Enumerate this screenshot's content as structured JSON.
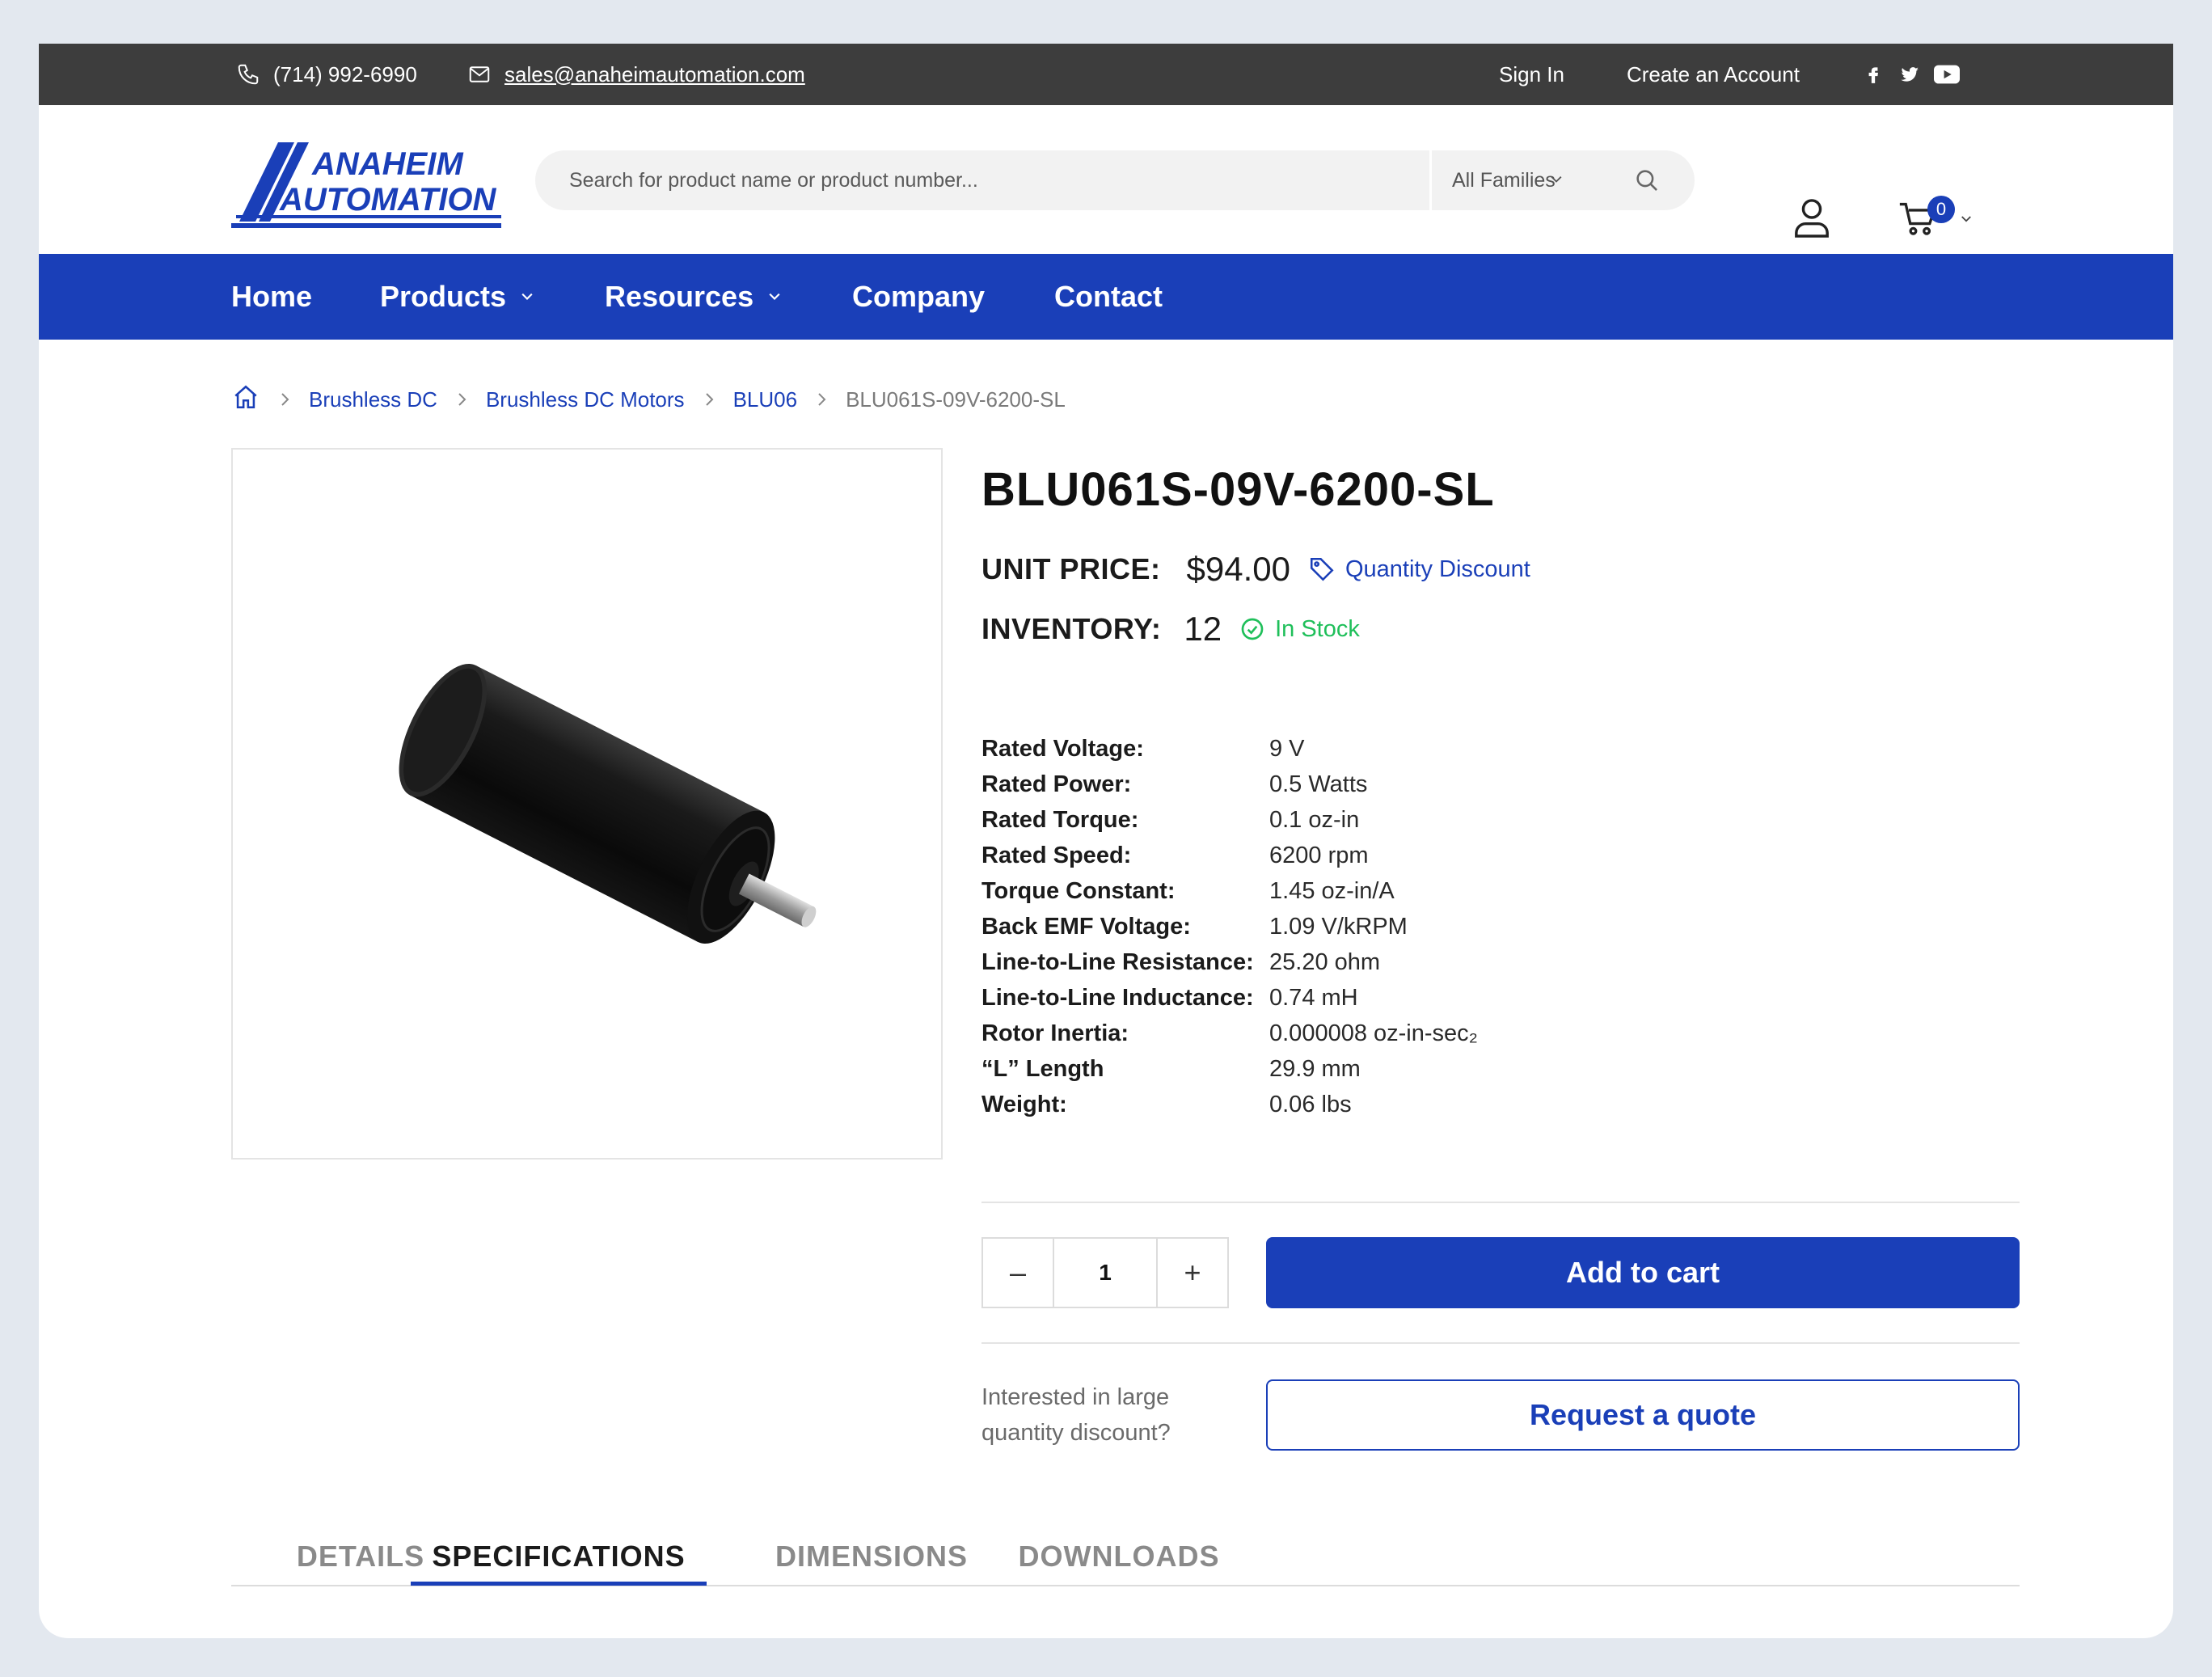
{
  "topbar": {
    "phone": "(714) 992-6990",
    "email": "sales@anaheimautomation.com",
    "sign_in": "Sign In",
    "create_account": "Create an Account",
    "social_icons": [
      "facebook-icon",
      "twitter-icon",
      "youtube-icon"
    ]
  },
  "header": {
    "logo_text": [
      "ANAHEIM",
      "AUTOMATION"
    ],
    "search_placeholder": "Search for product name or product number...",
    "family_select": "All Families",
    "cart_count": "0"
  },
  "nav": {
    "items": [
      {
        "label": "Home"
      },
      {
        "label": "Products"
      },
      {
        "label": "Resources"
      },
      {
        "label": "Company"
      },
      {
        "label": "Contact"
      }
    ]
  },
  "breadcrumb": {
    "items": [
      "Brushless DC",
      "Brushless DC Motors",
      "BLU06"
    ],
    "current": "BLU061S-09V-6200-SL"
  },
  "product": {
    "title": "BLU061S-09V-6200-SL",
    "price_label": "UNIT PRICE:",
    "price": "$94.00",
    "quantity_discount": "Quantity Discount",
    "inventory_label": "INVENTORY:",
    "inventory": "12",
    "stock_status": "In Stock",
    "specs": [
      {
        "k": "Rated Voltage:",
        "v": "9 V"
      },
      {
        "k": "Rated Power:",
        "v": "0.5 Watts"
      },
      {
        "k": "Rated Torque:",
        "v": "0.1 oz-in"
      },
      {
        "k": "Rated Speed:",
        "v": "6200 rpm"
      },
      {
        "k": "Torque Constant:",
        "v": "1.45 oz-in/A"
      },
      {
        "k": "Back EMF Voltage:",
        "v": "1.09 V/kRPM"
      },
      {
        "k": "Line-to-Line Resistance:",
        "v": "25.20 ohm"
      },
      {
        "k": "Line-to-Line Inductance:",
        "v": "0.74 mH"
      },
      {
        "k": "Rotor Inertia:",
        "v": "0.000008 oz-in-sec₂"
      },
      {
        "k": "“L” Length",
        "v": "29.9 mm"
      },
      {
        "k": "Weight:",
        "v": "0.06 lbs"
      }
    ],
    "quantity": "1",
    "minus": "–",
    "plus": "+",
    "add_to_cart": "Add to cart",
    "interest_text": "Interested in large quantity discount?",
    "request_quote": "Request a quote"
  },
  "tabs": {
    "items": [
      "DETAILS",
      "SPECIFICATIONS",
      "DIMENSIONS",
      "DOWNLOADS"
    ],
    "active": "SPECIFICATIONS"
  },
  "colors": {
    "brand_blue": "#1a3fb8",
    "topbar": "#3d3d3d",
    "in_stock_green": "#1fbf5a"
  }
}
